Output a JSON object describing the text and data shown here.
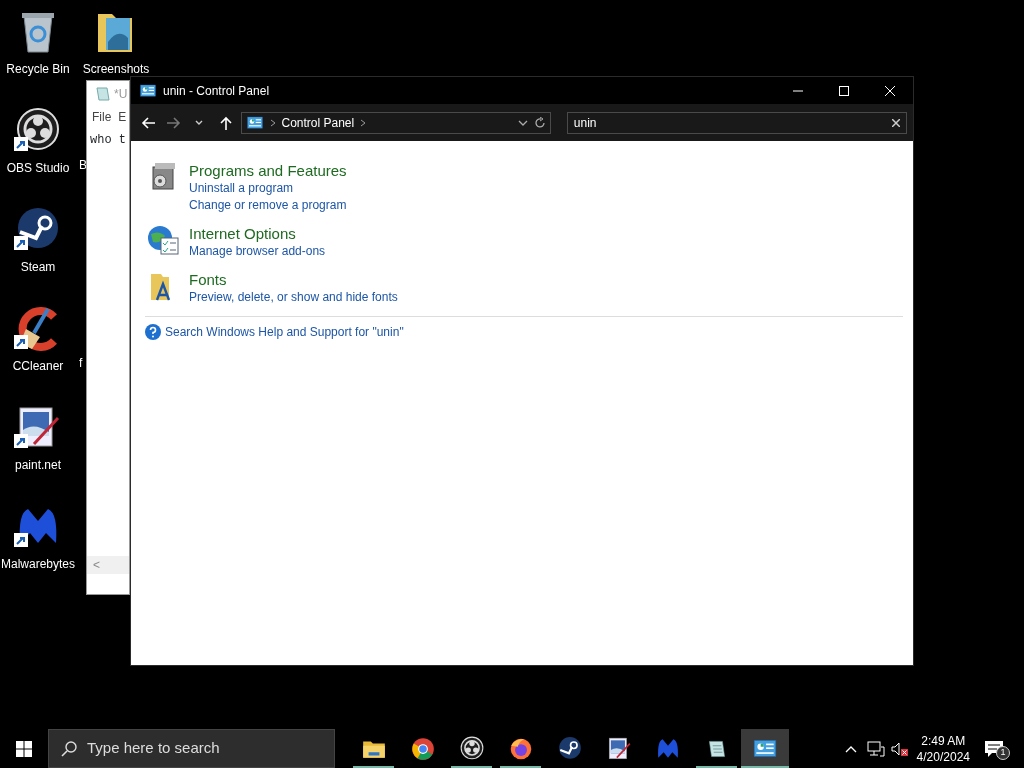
{
  "desktop": {
    "icons": [
      {
        "label": "Recycle Bin",
        "kind": "recycle",
        "shortcut": false
      },
      {
        "label": "Screenshots",
        "kind": "folder",
        "shortcut": false
      },
      {
        "label": "OBS Studio",
        "kind": "obs",
        "shortcut": true
      },
      {
        "label": "Steam",
        "kind": "steam",
        "shortcut": true
      },
      {
        "label": "CCleaner",
        "kind": "ccleaner",
        "shortcut": true
      },
      {
        "label": "paint.net",
        "kind": "paint",
        "shortcut": true
      },
      {
        "label": "Malwarebytes",
        "kind": "malware",
        "shortcut": true
      }
    ],
    "cut_labels": [
      {
        "label": "B"
      },
      {
        "label": "f"
      }
    ]
  },
  "notepad": {
    "title": "*U",
    "menu": [
      "File",
      "E"
    ],
    "text": "who t",
    "scroll_arrow": "<"
  },
  "window": {
    "title": "unin - Control Panel",
    "address": [
      "Control Panel"
    ],
    "search": {
      "value": "unin"
    },
    "results": [
      {
        "title": "Programs and Features",
        "kind": "programs",
        "links": [
          "Uninstall a program",
          "Change or remove a program"
        ]
      },
      {
        "title": "Internet Options",
        "kind": "internet",
        "links": [
          "Manage browser add-ons"
        ]
      },
      {
        "title": "Fonts",
        "kind": "fonts",
        "links": [
          "Preview, delete, or show and hide fonts"
        ]
      }
    ],
    "help_link": "Search Windows Help and Support for \"unin\""
  },
  "taskbar": {
    "search_placeholder": "Type here to search",
    "apps": [
      {
        "kind": "explorer",
        "running": true,
        "selected": false
      },
      {
        "kind": "chrome",
        "running": false,
        "selected": false
      },
      {
        "kind": "obs",
        "running": true,
        "selected": false
      },
      {
        "kind": "firefox",
        "running": true,
        "selected": false
      },
      {
        "kind": "steam",
        "running": false,
        "selected": false
      },
      {
        "kind": "paint",
        "running": false,
        "selected": false
      },
      {
        "kind": "malware",
        "running": false,
        "selected": false
      },
      {
        "kind": "notepad",
        "running": true,
        "selected": false
      },
      {
        "kind": "control",
        "running": true,
        "selected": true
      }
    ],
    "time": "2:49 AM",
    "date": "4/20/2024",
    "notification_count": "1"
  }
}
